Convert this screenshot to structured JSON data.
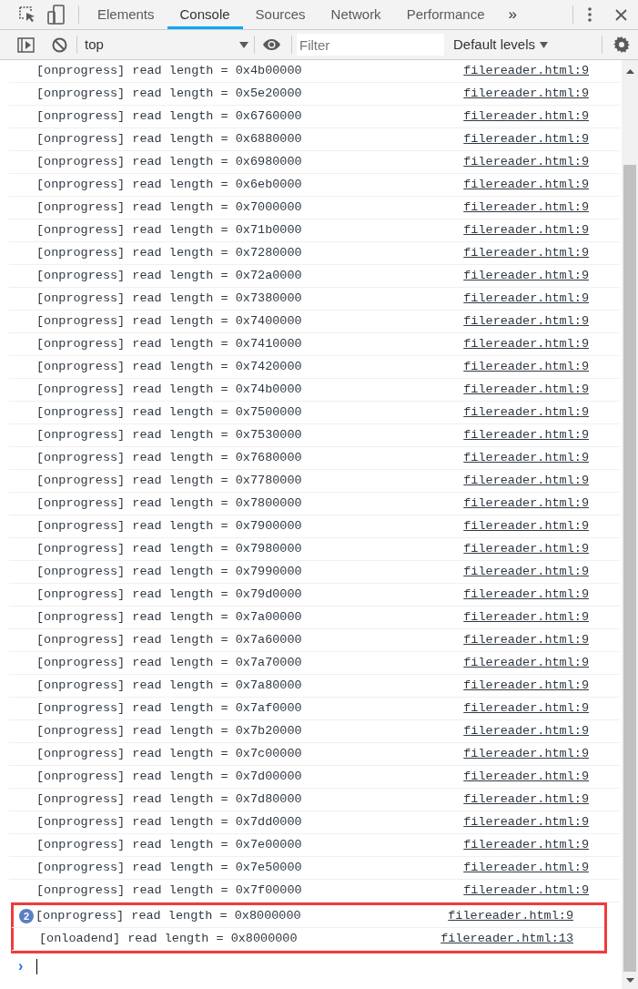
{
  "tabs": [
    {
      "label": "Elements",
      "selected": false
    },
    {
      "label": "Console",
      "selected": true
    },
    {
      "label": "Sources",
      "selected": false
    },
    {
      "label": "Network",
      "selected": false
    },
    {
      "label": "Performance",
      "selected": false
    }
  ],
  "more_tabs": "»",
  "toolbar": {
    "context": "top",
    "filter": {
      "placeholder": "Filter"
    },
    "levels": "Default levels"
  },
  "messages": [
    {
      "text": "[onprogress] read length = 0x4b00000",
      "source": "filereader.html:9"
    },
    {
      "text": "[onprogress] read length = 0x5e20000",
      "source": "filereader.html:9"
    },
    {
      "text": "[onprogress] read length = 0x6760000",
      "source": "filereader.html:9"
    },
    {
      "text": "[onprogress] read length = 0x6880000",
      "source": "filereader.html:9"
    },
    {
      "text": "[onprogress] read length = 0x6980000",
      "source": "filereader.html:9"
    },
    {
      "text": "[onprogress] read length = 0x6eb0000",
      "source": "filereader.html:9"
    },
    {
      "text": "[onprogress] read length = 0x7000000",
      "source": "filereader.html:9"
    },
    {
      "text": "[onprogress] read length = 0x71b0000",
      "source": "filereader.html:9"
    },
    {
      "text": "[onprogress] read length = 0x7280000",
      "source": "filereader.html:9"
    },
    {
      "text": "[onprogress] read length = 0x72a0000",
      "source": "filereader.html:9"
    },
    {
      "text": "[onprogress] read length = 0x7380000",
      "source": "filereader.html:9"
    },
    {
      "text": "[onprogress] read length = 0x7400000",
      "source": "filereader.html:9"
    },
    {
      "text": "[onprogress] read length = 0x7410000",
      "source": "filereader.html:9"
    },
    {
      "text": "[onprogress] read length = 0x7420000",
      "source": "filereader.html:9"
    },
    {
      "text": "[onprogress] read length = 0x74b0000",
      "source": "filereader.html:9"
    },
    {
      "text": "[onprogress] read length = 0x7500000",
      "source": "filereader.html:9"
    },
    {
      "text": "[onprogress] read length = 0x7530000",
      "source": "filereader.html:9"
    },
    {
      "text": "[onprogress] read length = 0x7680000",
      "source": "filereader.html:9"
    },
    {
      "text": "[onprogress] read length = 0x7780000",
      "source": "filereader.html:9"
    },
    {
      "text": "[onprogress] read length = 0x7800000",
      "source": "filereader.html:9"
    },
    {
      "text": "[onprogress] read length = 0x7900000",
      "source": "filereader.html:9"
    },
    {
      "text": "[onprogress] read length = 0x7980000",
      "source": "filereader.html:9"
    },
    {
      "text": "[onprogress] read length = 0x7990000",
      "source": "filereader.html:9"
    },
    {
      "text": "[onprogress] read length = 0x79d0000",
      "source": "filereader.html:9"
    },
    {
      "text": "[onprogress] read length = 0x7a00000",
      "source": "filereader.html:9"
    },
    {
      "text": "[onprogress] read length = 0x7a60000",
      "source": "filereader.html:9"
    },
    {
      "text": "[onprogress] read length = 0x7a70000",
      "source": "filereader.html:9"
    },
    {
      "text": "[onprogress] read length = 0x7a80000",
      "source": "filereader.html:9"
    },
    {
      "text": "[onprogress] read length = 0x7af0000",
      "source": "filereader.html:9"
    },
    {
      "text": "[onprogress] read length = 0x7b20000",
      "source": "filereader.html:9"
    },
    {
      "text": "[onprogress] read length = 0x7c00000",
      "source": "filereader.html:9"
    },
    {
      "text": "[onprogress] read length = 0x7d00000",
      "source": "filereader.html:9"
    },
    {
      "text": "[onprogress] read length = 0x7d80000",
      "source": "filereader.html:9"
    },
    {
      "text": "[onprogress] read length = 0x7dd0000",
      "source": "filereader.html:9"
    },
    {
      "text": "[onprogress] read length = 0x7e00000",
      "source": "filereader.html:9"
    },
    {
      "text": "[onprogress] read length = 0x7e50000",
      "source": "filereader.html:9"
    },
    {
      "text": "[onprogress] read length = 0x7f00000",
      "source": "filereader.html:9"
    },
    {
      "text": "[onprogress] read length = 0x8000000",
      "source": "filereader.html:9",
      "count": "2",
      "highlighted": true
    },
    {
      "text": "[onloadend] read length = 0x8000000",
      "source": "filereader.html:13",
      "highlighted": true
    }
  ],
  "prompt": "›"
}
